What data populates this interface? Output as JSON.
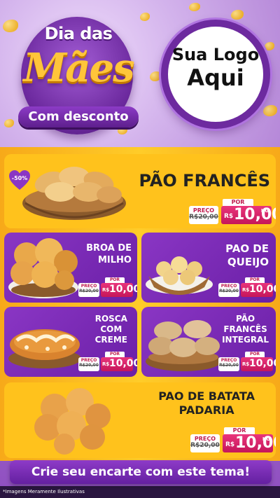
{
  "header": {
    "title_top": "Dia das",
    "title_main": "Mães",
    "title_bottom": "Com desconto",
    "logo_line1": "Sua Logo",
    "logo_line2": "Aqui"
  },
  "discount_badge": "-50%",
  "products": [
    {
      "name": "PÃO FRANCÊS",
      "old_label": "PREÇO",
      "old_price": "R$20,00",
      "por_label": "POR",
      "currency": "R$",
      "price": "10,00",
      "unit": "KG"
    },
    {
      "name_lines": [
        "BROA DE",
        "MILHO"
      ],
      "old_label": "PREÇO",
      "old_price": "R$20,00",
      "por_label": "POR",
      "currency": "R$",
      "price": "10,00"
    },
    {
      "name_lines": [
        "PAO DE",
        "QUEIJO"
      ],
      "old_label": "PREÇO",
      "old_price": "R$20,00",
      "por_label": "POR",
      "currency": "R$",
      "price": "10,00"
    },
    {
      "name_lines": [
        "ROSCA",
        "COM",
        "CREME"
      ],
      "old_label": "PREÇO",
      "old_price": "R$20,00",
      "por_label": "POR",
      "currency": "R$",
      "price": "10,00"
    },
    {
      "name_lines": [
        "PÃO",
        "FRANCÊS",
        "INTEGRAL"
      ],
      "old_label": "PREÇO",
      "old_price": "R$20,00",
      "por_label": "POR",
      "currency": "R$",
      "price": "10,00"
    },
    {
      "name_lines": [
        "PAO DE BATATA",
        "PADARIA"
      ],
      "old_label": "PREÇO",
      "old_price": "R$20,00",
      "por_label": "POR",
      "currency": "R$",
      "price": "10,00",
      "unit": "KG"
    }
  ],
  "cta": "Crie seu encarte com este tema!",
  "disclaimer": "*Imagens Meramente Ilustrativas",
  "colors": {
    "purple": "#7a2bb5",
    "yellow": "#ffc21c",
    "pink": "#d41f66",
    "gold": "#ffc53a"
  }
}
